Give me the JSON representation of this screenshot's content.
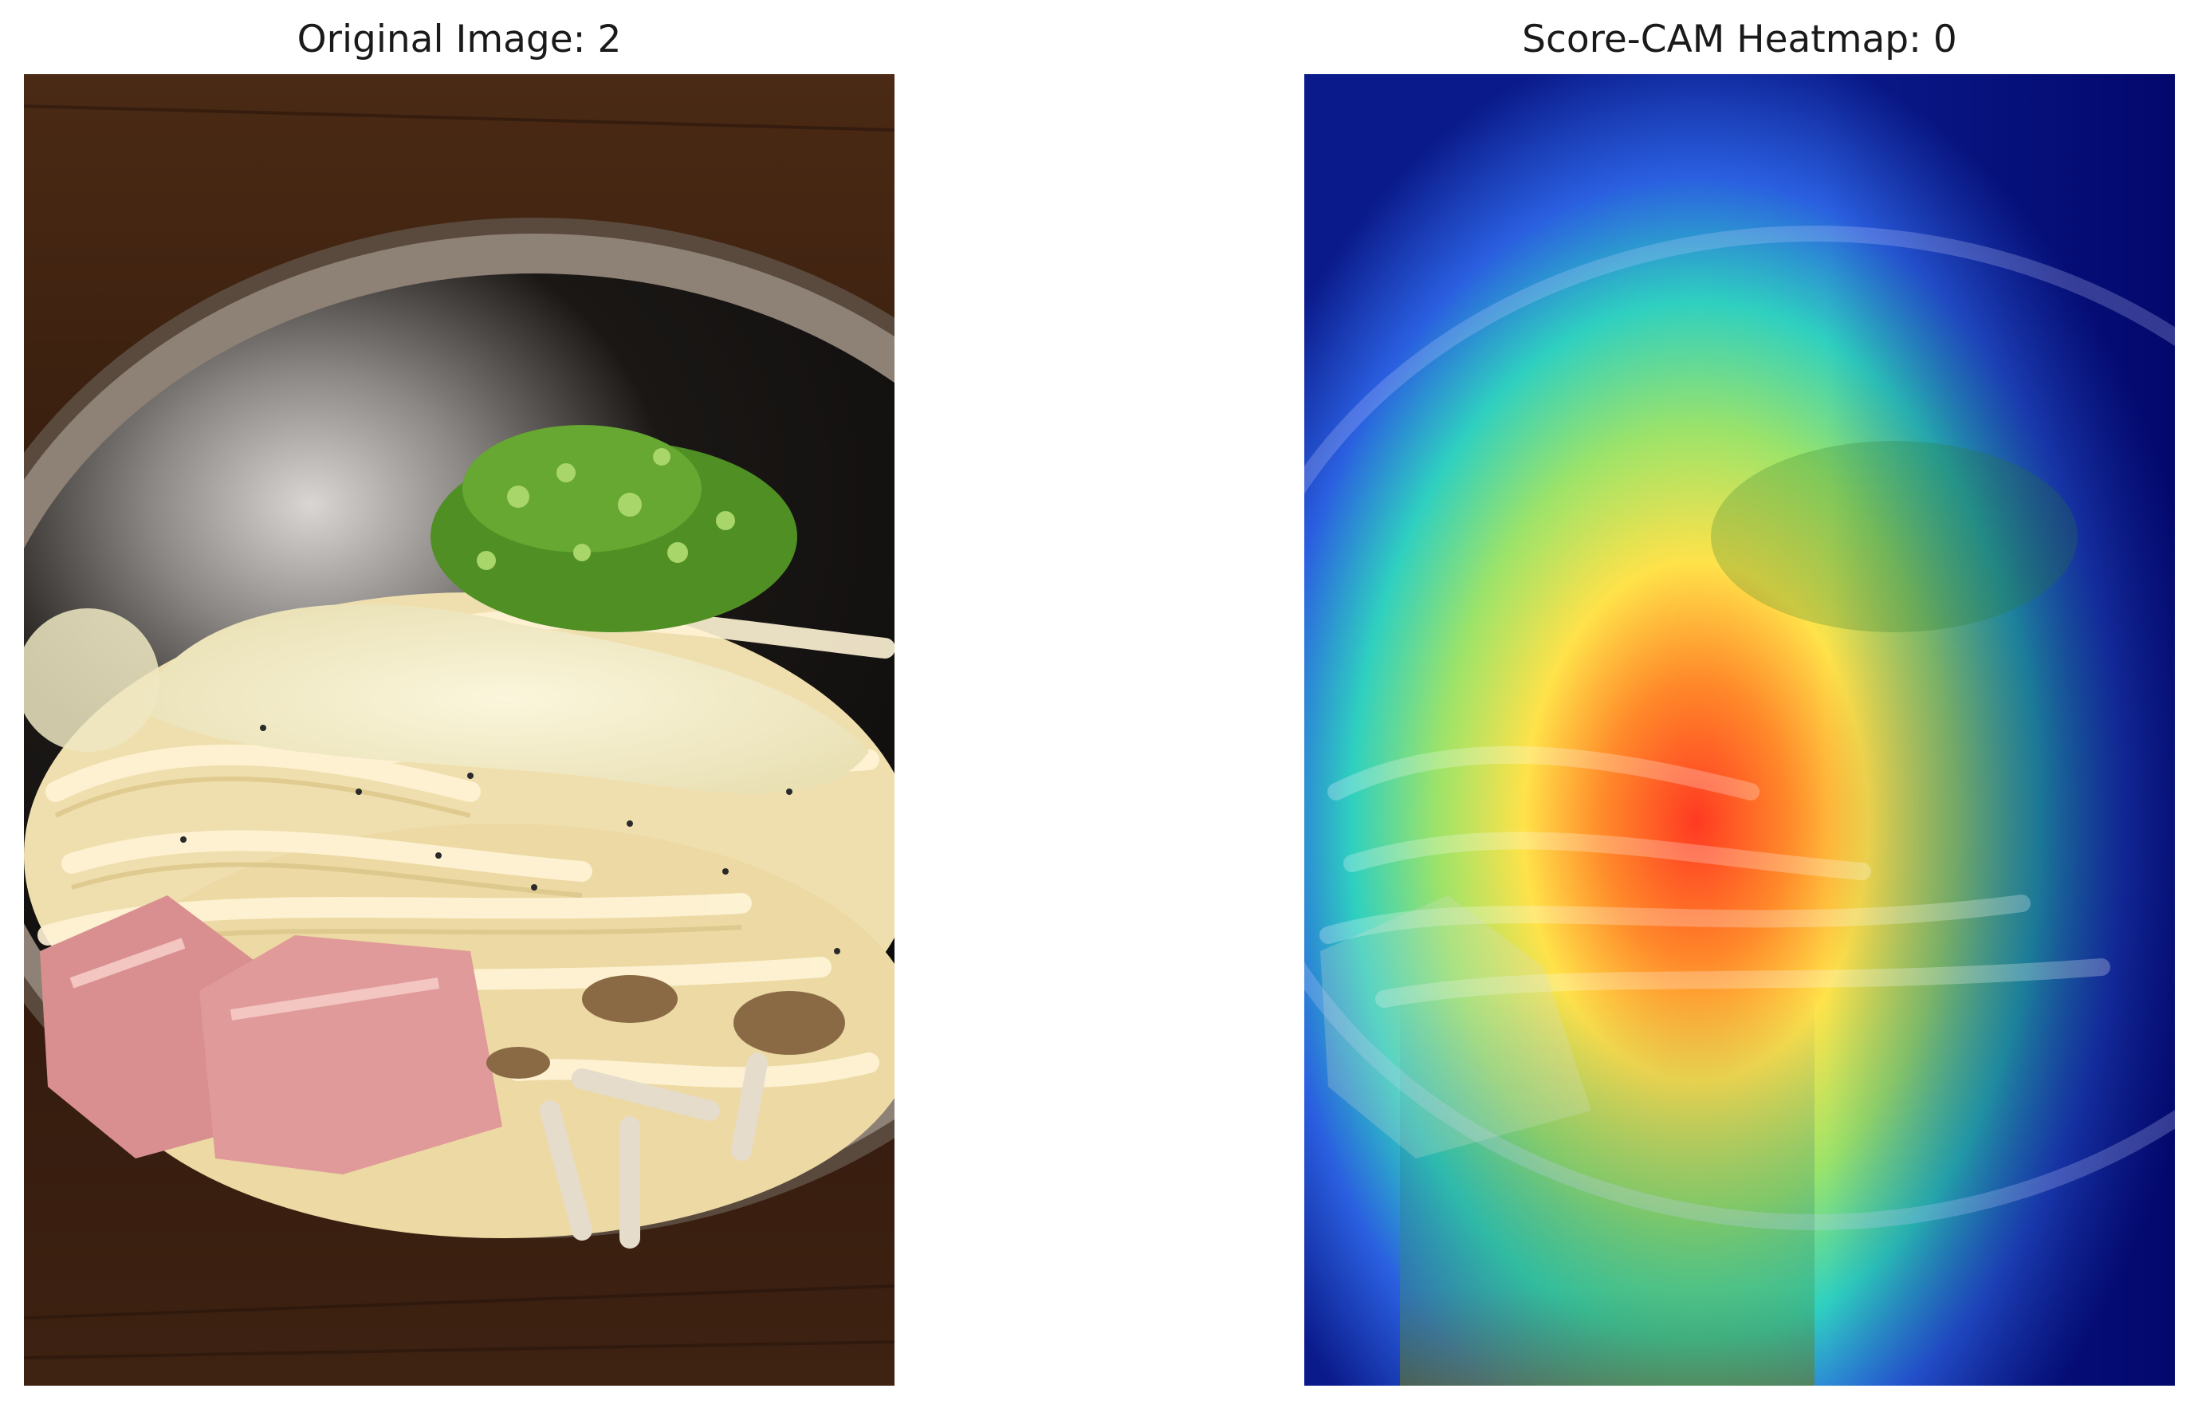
{
  "panels": [
    {
      "title": "Original Image: 2"
    },
    {
      "title": "Score-CAM Heatmap: 0"
    }
  ],
  "colors": {
    "table_wood": "#3a1f10",
    "bowl_rim": "#6b5a4a",
    "bowl_inside": "#0f0d0c",
    "noodle": "#f1e3b8",
    "bacon": "#d98f8f",
    "scallion": "#4f8f24",
    "mushroom": "#8a6a45",
    "heatmap_low": "#0a1a8a",
    "heatmap_mid": "#2fd0c0",
    "heatmap_high": "#ff3a22"
  },
  "icons": [
    "food-photo",
    "heatmap-overlay"
  ]
}
